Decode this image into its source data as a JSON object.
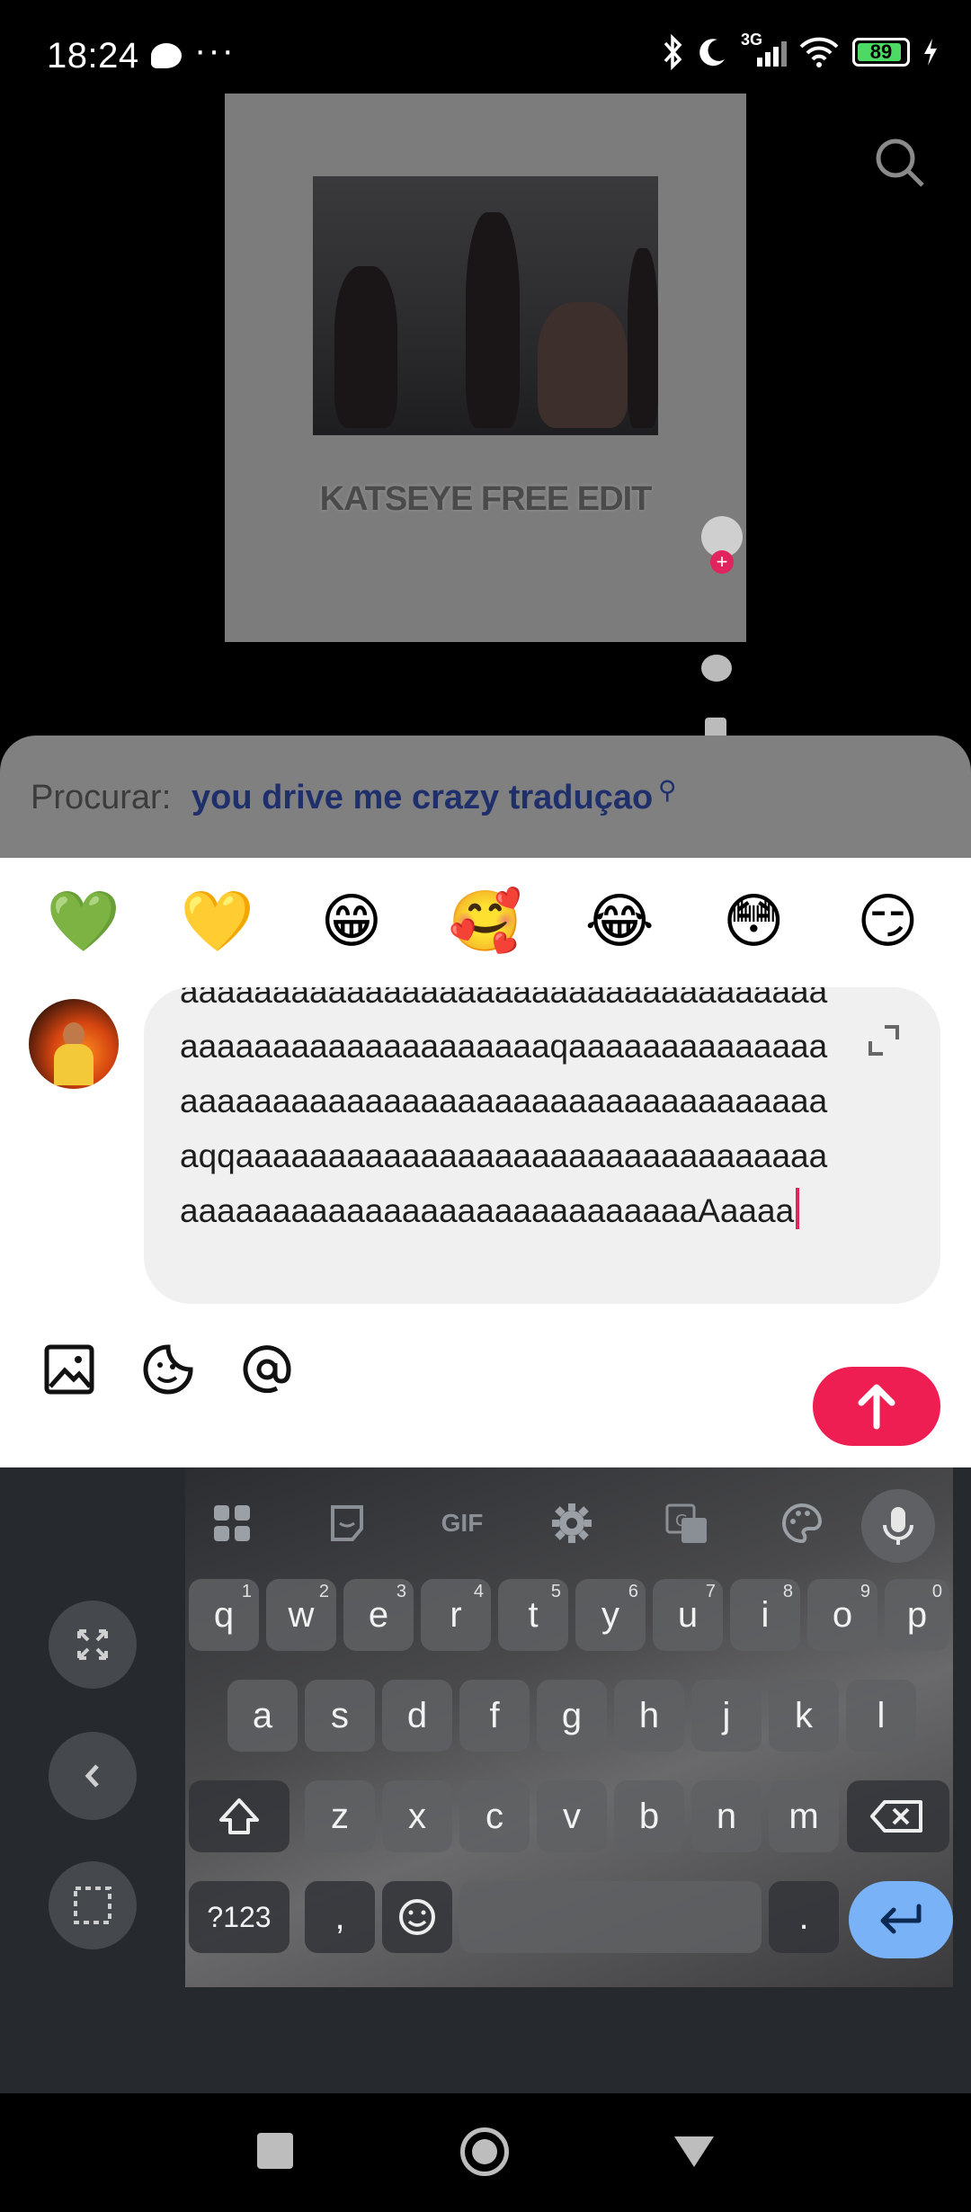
{
  "status_bar": {
    "time": "18:24",
    "more": "···",
    "battery": "89",
    "network": "3G"
  },
  "video": {
    "caption": "KATSEYE FREE EDIT"
  },
  "search_suggestion": {
    "label": "Procurar:",
    "query": "you drive me crazy traduçao"
  },
  "emoji_bar": [
    "💚",
    "💛",
    "😁",
    "🥰",
    "😂",
    "😳",
    "😏"
  ],
  "comment": {
    "text": "aaaaaaaaaaaaaaaaaaaaaaaaaaaaaaaaaaaaaaaaaaaaaaaaaaaaaaaqaaaaaaaaaaaaaaaaaaaaaaaaaaaaaaaaaaaaaaaaaaaaaaaaaaqqaaaaaaaaaaaaaaaaaaaaaaaaaaaaaaaaaaaaaaaaaaaaaaaaaaaaaaaaaaaaAaaaa"
  },
  "keyboard": {
    "toolbar": {
      "gif": "GIF"
    },
    "row1": [
      [
        "q",
        "1"
      ],
      [
        "w",
        "2"
      ],
      [
        "e",
        "3"
      ],
      [
        "r",
        "4"
      ],
      [
        "t",
        "5"
      ],
      [
        "y",
        "6"
      ],
      [
        "u",
        "7"
      ],
      [
        "i",
        "8"
      ],
      [
        "o",
        "9"
      ],
      [
        "p",
        "0"
      ]
    ],
    "row2": [
      "a",
      "s",
      "d",
      "f",
      "g",
      "h",
      "j",
      "k",
      "l"
    ],
    "row3": [
      "z",
      "x",
      "c",
      "v",
      "b",
      "n",
      "m"
    ],
    "symbols": "?123",
    "comma": ",",
    "period": "."
  },
  "colors": {
    "accent": "#ee1d52",
    "query": "#1f2f6b",
    "enter": "#7ab2f8"
  }
}
